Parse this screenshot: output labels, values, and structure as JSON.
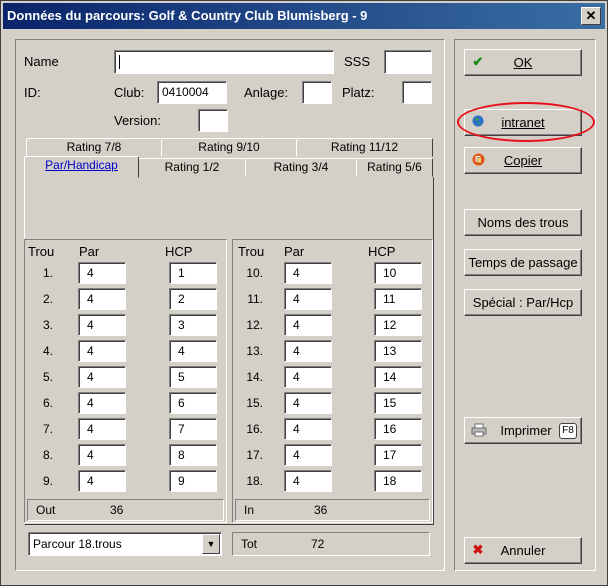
{
  "window": {
    "title": "Données du parcours: Golf & Country Club Blumisberg - 9",
    "close": "✕"
  },
  "form": {
    "name_label": "Name",
    "name_value": "",
    "sss_label": "SSS",
    "sss_value": "",
    "id_label": "ID:",
    "club_label": "Club:",
    "club_value": "0410004",
    "anlage_label": "Anlage:",
    "anlage_value": "",
    "platz_label": "Platz:",
    "platz_value": "",
    "version_label": "Version:",
    "version_value": ""
  },
  "tabs": {
    "row1": [
      "Rating 7/8",
      "Rating 9/10",
      "Rating 11/12"
    ],
    "row2": [
      "Par/Handicap",
      "Rating 1/2",
      "Rating 3/4",
      "Rating 5/6"
    ]
  },
  "headers": {
    "trou": "Trou",
    "par": "Par",
    "hcp": "HCP"
  },
  "left_holes": [
    {
      "n": "1.",
      "par": "4",
      "hcp": "1"
    },
    {
      "n": "2.",
      "par": "4",
      "hcp": "2"
    },
    {
      "n": "3.",
      "par": "4",
      "hcp": "3"
    },
    {
      "n": "4.",
      "par": "4",
      "hcp": "4"
    },
    {
      "n": "5.",
      "par": "4",
      "hcp": "5"
    },
    {
      "n": "6.",
      "par": "4",
      "hcp": "6"
    },
    {
      "n": "7.",
      "par": "4",
      "hcp": "7"
    },
    {
      "n": "8.",
      "par": "4",
      "hcp": "8"
    },
    {
      "n": "9.",
      "par": "4",
      "hcp": "9"
    }
  ],
  "right_holes": [
    {
      "n": "10.",
      "par": "4",
      "hcp": "10"
    },
    {
      "n": "11.",
      "par": "4",
      "hcp": "11"
    },
    {
      "n": "12.",
      "par": "4",
      "hcp": "12"
    },
    {
      "n": "13.",
      "par": "4",
      "hcp": "13"
    },
    {
      "n": "14.",
      "par": "4",
      "hcp": "14"
    },
    {
      "n": "15.",
      "par": "4",
      "hcp": "15"
    },
    {
      "n": "16.",
      "par": "4",
      "hcp": "16"
    },
    {
      "n": "17.",
      "par": "4",
      "hcp": "17"
    },
    {
      "n": "18.",
      "par": "4",
      "hcp": "18"
    }
  ],
  "totals": {
    "out_label": "Out",
    "out_value": "36",
    "in_label": "In",
    "in_value": "36",
    "tot_label": "Tot",
    "tot_value": "72"
  },
  "course_select": {
    "value": "Parcour 18.trous"
  },
  "buttons": {
    "ok": "OK",
    "intranet": "intranet",
    "copier": "Copier",
    "noms": "Noms des trous",
    "temps": "Temps de passage",
    "special": "Spécial : Par/Hcp",
    "imprimer": "Imprimer",
    "imprimer_key": "F8",
    "annuler": "Annuler"
  },
  "colors": {
    "highlight_ring": "#e8101a",
    "title_bar": "#0a246a"
  },
  "icons": {
    "ok": "check-icon",
    "intranet": "globe-icon",
    "copier": "copy-icon",
    "imprimer": "printer-icon",
    "annuler": "x-icon"
  }
}
